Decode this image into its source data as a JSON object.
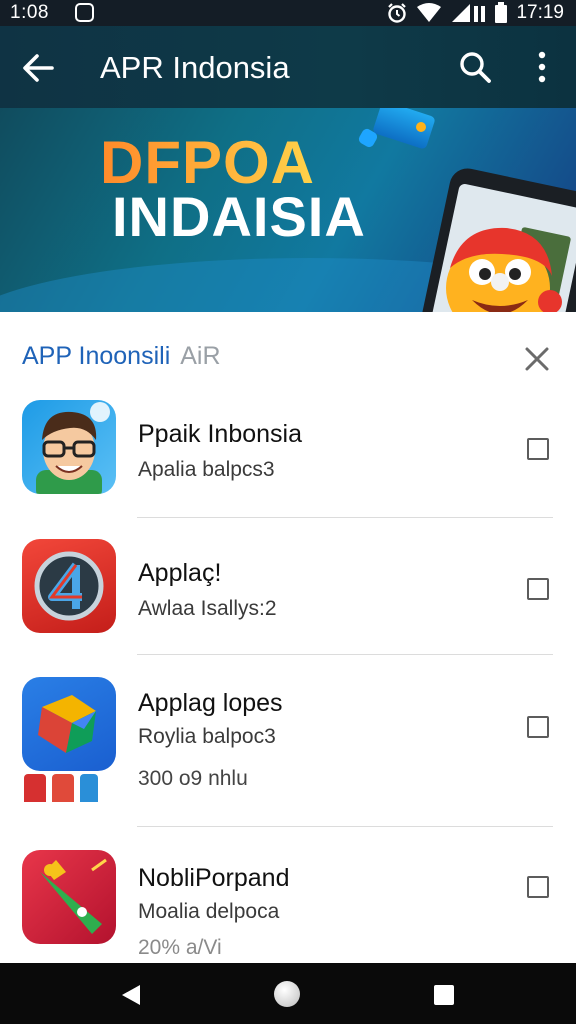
{
  "status_bar": {
    "time_left": "1:08",
    "time_right": "17:19",
    "icons": [
      "notification-icon",
      "alarm-icon",
      "wifi-icon",
      "signal-icon",
      "battery-icon"
    ]
  },
  "app_bar": {
    "title": "APR Indonsia",
    "icons": [
      "back-arrow-icon",
      "search-icon",
      "more-vert-icon"
    ]
  },
  "banner": {
    "line1": "DFPOA",
    "line2": "INDAISIA",
    "colors": {
      "gradient_start": "#104c5e",
      "gradient_end": "#163c82",
      "title_orange": "#ff9a2e"
    }
  },
  "sheet": {
    "title": "APP Inoonsili",
    "title_faded": "AiR",
    "accent": "#1f63b8",
    "items": [
      {
        "name": "Ppaik Inbonsia",
        "subtitle": "Apalia balpcs3",
        "extra": "",
        "icon": "avatar-glasses-icon",
        "checked": false
      },
      {
        "name": "Applaç!",
        "subtitle": "Awlaa Isallys:2",
        "extra": "",
        "icon": "compass-a-icon",
        "checked": false
      },
      {
        "name": "Applag lopes",
        "subtitle": "Roylia balpoc3",
        "extra": "300 o9 nhlu",
        "icon": "google-g-icon",
        "checked": false
      },
      {
        "name": "NobliPorpand",
        "subtitle": "Moalia delpoca",
        "extra": "20% a/Vi",
        "icon": "party-horn-icon",
        "checked": false
      }
    ]
  },
  "nav_bar": {
    "icons": [
      "nav-back-icon",
      "nav-home-icon",
      "nav-recents-icon"
    ]
  }
}
